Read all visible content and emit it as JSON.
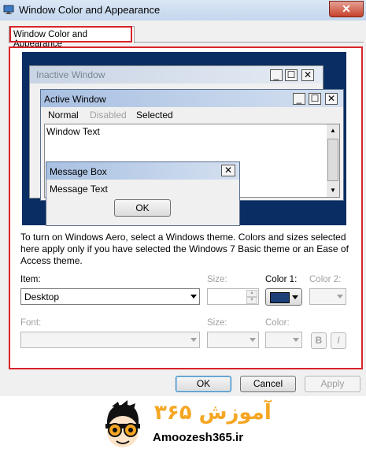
{
  "window": {
    "title": "Window Color and Appearance",
    "close_glyph": "✕",
    "icon": "monitor-icon"
  },
  "tab": {
    "label": "Window Color and Appearance"
  },
  "preview": {
    "inactive_window": {
      "title": "Inactive Window"
    },
    "active_window": {
      "title": "Active Window",
      "menu": [
        "Normal",
        "Disabled",
        "Selected"
      ],
      "window_text": "Window Text"
    },
    "message_box": {
      "title": "Message Box",
      "text": "Message Text",
      "ok_label": "OK"
    },
    "caption_glyphs": {
      "minimize": "_",
      "maximize": "☐",
      "close": "✕"
    }
  },
  "description": "To turn on Windows Aero, select a Windows theme.  Colors and sizes selected here apply only if you have selected the Windows 7 Basic theme or an Ease of Access theme.",
  "item_row": {
    "item_label": "Item:",
    "item_value": "Desktop",
    "size_label": "Size:",
    "size_value": "",
    "color1_label": "Color 1:",
    "color1_value": "#1c3f78",
    "color2_label": "Color 2:"
  },
  "font_row": {
    "font_label": "Font:",
    "font_value": "",
    "size_label": "Size:",
    "color_label": "Color:",
    "bold_label": "B",
    "italic_label": "I"
  },
  "buttons": {
    "ok": "OK",
    "cancel": "Cancel",
    "apply": "Apply"
  },
  "logo": {
    "persian_text": "آموزش ۳۶۵",
    "english_text": "Amoozesh365.ir"
  },
  "colors": {
    "preview_desktop": "#0a2e63",
    "highlight_border": "#d9232a",
    "logo_accent": "#f5a623"
  }
}
